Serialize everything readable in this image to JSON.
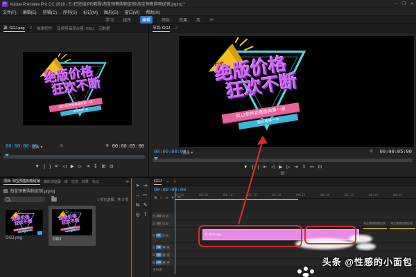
{
  "window": {
    "title": "Adobe Premiere Pro CC 2018 - E:\\已完结\\PR教程\\淘宝预售购物促销\\淘宝预售购物促销.prproj *",
    "app_icon_label": "Pr",
    "controls": {
      "minimize": "─",
      "maximize": "❐",
      "close": "✕"
    }
  },
  "menu_bar": {
    "items": [
      "文件(F)",
      "编辑(E)",
      "剪辑(C)",
      "序列(S)",
      "标记(M)",
      "图形(G)",
      "窗口(W)",
      "帮助(H)"
    ]
  },
  "workspace_bar": {
    "items": [
      "学习",
      "组件",
      "编辑",
      "颜色",
      "效果",
      "库"
    ],
    "active_item": "编辑",
    "overflow_icon": "≫"
  },
  "source_monitor": {
    "tabs": {
      "active": "源: GGJ.png",
      "t2": "效果控件",
      "t3": "音频剪辑混合器: GGJ",
      "t4": "元数据"
    },
    "panel_menu_icon": "≡",
    "timecode_current": "00:00:00:00",
    "zoom_select": "适合",
    "zoom_caret": "▾",
    "res_icon": "⊙",
    "settings_icon": "⚙",
    "timecode_duration": "00:00:05:00",
    "transport": [
      {
        "name": "add-marker-icon",
        "glyph": "▼"
      },
      {
        "name": "mark-in-icon",
        "glyph": "{"
      },
      {
        "name": "mark-out-icon",
        "glyph": "}"
      },
      {
        "name": "go-to-in-icon",
        "glyph": "⇤"
      },
      {
        "name": "step-back-icon",
        "glyph": "◁"
      },
      {
        "name": "play-icon",
        "glyph": "▶"
      },
      {
        "name": "step-forward-icon",
        "glyph": "▷"
      },
      {
        "name": "go-to-out-icon",
        "glyph": "⇥"
      },
      {
        "name": "insert-icon",
        "glyph": "↧"
      },
      {
        "name": "overwrite-icon",
        "glyph": "⊞"
      },
      {
        "name": "export-frame-icon",
        "glyph": "⊡"
      }
    ]
  },
  "program_monitor": {
    "tab": "节目: GGJ",
    "panel_menu_icon": "≡",
    "timecode_current": "00:00:00:00",
    "zoom_select": "适合",
    "zoom_caret": "▾",
    "settings_icon": "⚙",
    "timecode_total": "00:00:05:00",
    "comparison_icon": "⊡",
    "transport": [
      {
        "name": "add-marker-icon",
        "glyph": "▼"
      },
      {
        "name": "mark-in-icon",
        "glyph": "{"
      },
      {
        "name": "mark-out-icon",
        "glyph": "}"
      },
      {
        "name": "go-to-in-icon",
        "glyph": "⇤"
      },
      {
        "name": "step-back-icon",
        "glyph": "◁"
      },
      {
        "name": "play-icon",
        "glyph": "▶"
      },
      {
        "name": "step-forward-icon",
        "glyph": "▷"
      },
      {
        "name": "go-to-out-icon",
        "glyph": "⇥"
      },
      {
        "name": "lift-icon",
        "glyph": "↥"
      },
      {
        "name": "extract-icon",
        "glyph": "↤"
      },
      {
        "name": "export-frame-icon",
        "glyph": "⊡"
      }
    ]
  },
  "promo": {
    "burst_text": "预售",
    "headline1": "绝版价格",
    "headline2": "狂欢不断",
    "ribbon_pink": "双12年终钜惠盛典第一波",
    "ribbon_blue": "错过再等一年"
  },
  "project_panel": {
    "tabs": {
      "active": "项目: 淘宝预售购物促销",
      "t2": "媒体浏览器",
      "t3": "库",
      "t4": "信息",
      "t5": "效果",
      "t6": "标记"
    },
    "overflow_icon": "≫",
    "project_file": "淘宝预售购物促销.prproj",
    "selection_status": "1 项已选择，共 2 项",
    "items": [
      {
        "label": "GGJ.png"
      },
      {
        "label": "GGJ"
      }
    ]
  },
  "tools": {
    "items": [
      {
        "name": "selection-tool",
        "glyph": "➤"
      },
      {
        "name": "track-select-forward-tool",
        "glyph": "⇥"
      },
      {
        "name": "ripple-edit-tool",
        "glyph": "↔"
      },
      {
        "name": "razor-tool",
        "glyph": "✂"
      },
      {
        "name": "slip-tool",
        "glyph": "⇆"
      },
      {
        "name": "pen-tool",
        "glyph": "✎"
      },
      {
        "name": "hand-tool",
        "glyph": "◎"
      },
      {
        "name": "type-tool",
        "glyph": "T"
      }
    ]
  },
  "timeline": {
    "tab": "GGJ",
    "close_icon": "×",
    "panel_menu_icon": "≡",
    "timecode": "00:00:00:00",
    "toolbar": [
      {
        "name": "nest-toggle-icon",
        "glyph": "⊞"
      },
      {
        "name": "snap-icon",
        "glyph": "∩"
      },
      {
        "name": "linked-selection-icon",
        "glyph": "∞"
      },
      {
        "name": "add-marker-icon",
        "glyph": "▼"
      },
      {
        "name": "timeline-settings-icon",
        "glyph": "⚙"
      }
    ],
    "ruler_labels": [
      "00:00",
      "00:05",
      "00:10",
      "00:15",
      "00:20",
      "00:25",
      "00:30",
      "00:35",
      "00:40",
      "00:45"
    ],
    "video_tracks": [
      {
        "label": "V3"
      },
      {
        "label": "V2"
      },
      {
        "label": "V1"
      }
    ],
    "audio_tracks": [
      {
        "label": "A1"
      },
      {
        "label": "A2"
      },
      {
        "label": "A3"
      }
    ],
    "mute_label": "M",
    "solo_label": "S",
    "master_label": "主声道",
    "clip_label": "fx GGJ.png",
    "right_clip_labels": [
      "淘宝预售购物促销",
      "淘宝预售购物促销"
    ]
  },
  "watermark": {
    "text": "头条 @性感的小面包"
  },
  "colors": {
    "accent_blue": "#2d8ceb",
    "timecode_blue": "#4aa3f5",
    "clip_pink": "#ea8ae2",
    "annotation_red": "#d22f27",
    "workbar_yellow": "#b3a033",
    "triangle_cyan": "#5adbe8",
    "headline_purple": "#cf6cf0",
    "megaphone_yellow": "#f2c01d",
    "ribbon_pink": "#e8639a",
    "ribbon_blue": "#3bb7d8"
  }
}
